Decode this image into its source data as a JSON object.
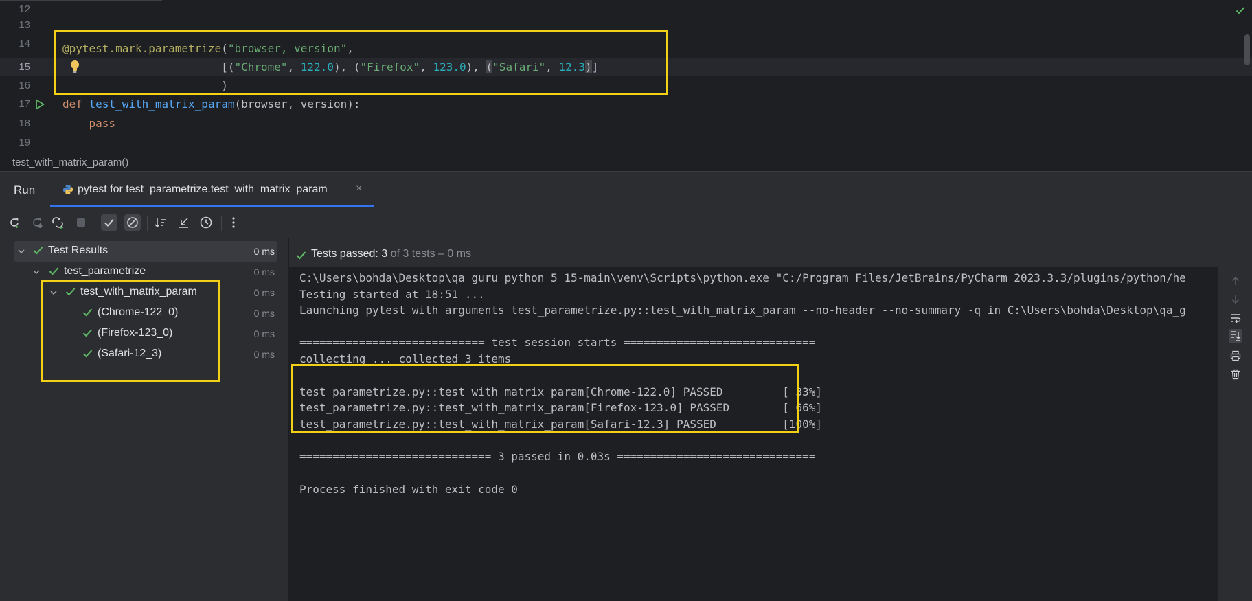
{
  "editor": {
    "line_numbers": [
      "12",
      "13",
      "14",
      "15",
      "16",
      "17",
      "18",
      "19"
    ],
    "code": {
      "l14": {
        "decorator": "@pytest.mark.parametrize",
        "open": "(",
        "arg1": "\"browser, version\"",
        "comma": ","
      },
      "l15": {
        "indent": "                        ",
        "p1": "[(",
        "s1": "\"Chrome\"",
        "c1": ", ",
        "n1": "122.0",
        "p2": "), (",
        "s2": "\"Firefox\"",
        "c2": ", ",
        "n2": "123.0",
        "p3": "), ",
        "p4": "(",
        "s3": "\"Safari\"",
        "c3": ", ",
        "n3a": "12.",
        "n3b": "3",
        "p5": ")",
        "p6": "]"
      },
      "l16": {
        "indent": "                        ",
        "close": ")"
      },
      "l17": {
        "kw": "def",
        "name": "test_with_matrix_param",
        "params": "(browser, version):"
      },
      "l18": {
        "indent": "    ",
        "kw": "pass"
      }
    },
    "breadcrumb": "test_with_matrix_param()"
  },
  "run_window": {
    "title": "Run",
    "tab_label": "pytest for test_parametrize.test_with_matrix_param",
    "tab_close": "×",
    "status": {
      "passed_label": "Tests passed: 3",
      "rest": " of 3 tests – 0 ms"
    }
  },
  "tree": [
    {
      "label": "Test Results",
      "time": "0 ms"
    },
    {
      "label": "test_parametrize",
      "time": "0 ms"
    },
    {
      "label": "test_with_matrix_param",
      "time": "0 ms"
    },
    {
      "label": "(Chrome-122_0)",
      "time": "0 ms"
    },
    {
      "label": "(Firefox-123_0)",
      "time": "0 ms"
    },
    {
      "label": "(Safari-12_3)",
      "time": "0 ms"
    }
  ],
  "console": {
    "lines": [
      "C:\\Users\\bohda\\Desktop\\qa_guru_python_5_15-main\\venv\\Scripts\\python.exe \"C:/Program Files/JetBrains/PyCharm 2023.3.3/plugins/python/he",
      "Testing started at 18:51 ...",
      "Launching pytest with arguments test_parametrize.py::test_with_matrix_param --no-header --no-summary -q in C:\\Users\\bohda\\Desktop\\qa_g",
      "",
      "============================ test session starts =============================",
      "collecting ... collected 3 items",
      "",
      "test_parametrize.py::test_with_matrix_param[Chrome-122.0] PASSED         [ 33%]",
      "test_parametrize.py::test_with_matrix_param[Firefox-123.0] PASSED        [ 66%]",
      "test_parametrize.py::test_with_matrix_param[Safari-12.3] PASSED          [100%]",
      "",
      "============================= 3 passed in 0.03s ==============================",
      "",
      "Process finished with exit code 0"
    ]
  },
  "icons": {
    "toolbar": [
      "rerun-icon",
      "rerun-failed-icon",
      "toggle-auto-test-icon",
      "stop-icon",
      "show-passed-icon",
      "show-ignored-icon",
      "sort-icon",
      "collapse-icon",
      "history-icon",
      "more-icon"
    ],
    "console_side": [
      "up-icon",
      "down-icon",
      "soft-wrap-icon",
      "scroll-to-end-icon",
      "print-icon",
      "clear-icon"
    ]
  },
  "colors": {
    "pass_green": "#5fb865",
    "highlight_yellow": "#f2d016",
    "accent_blue": "#3574f0"
  }
}
